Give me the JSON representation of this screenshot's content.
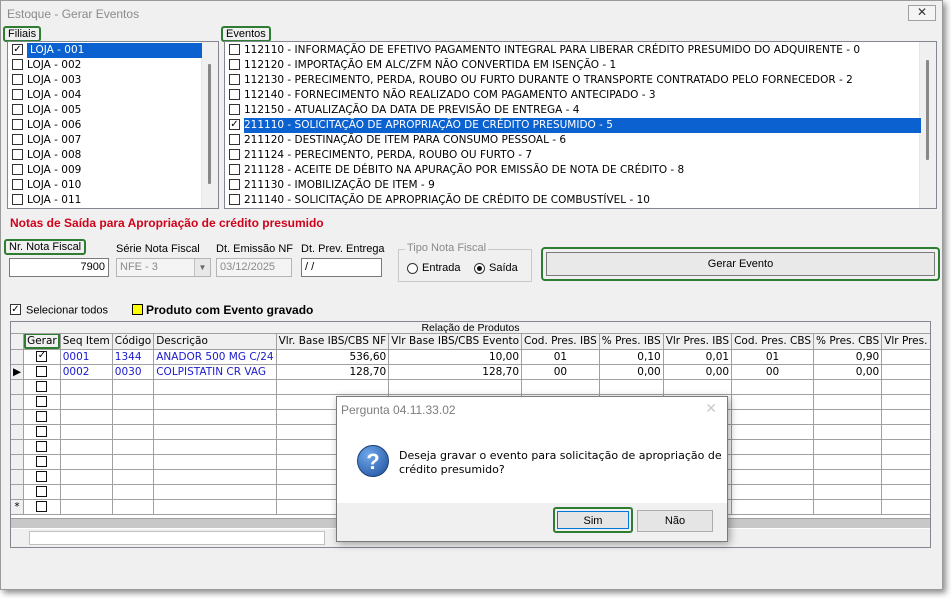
{
  "window": {
    "title": "Estoque - Gerar Eventos",
    "close_glyph": "✕"
  },
  "filiais": {
    "label": "Filiais",
    "items": [
      {
        "label": "LOJA - 001",
        "checked": true,
        "selected": true
      },
      {
        "label": "LOJA - 002",
        "checked": false
      },
      {
        "label": "LOJA - 003",
        "checked": false
      },
      {
        "label": "LOJA - 004",
        "checked": false
      },
      {
        "label": "LOJA - 005",
        "checked": false
      },
      {
        "label": "LOJA - 006",
        "checked": false
      },
      {
        "label": "LOJA - 007",
        "checked": false
      },
      {
        "label": "LOJA - 008",
        "checked": false
      },
      {
        "label": "LOJA - 009",
        "checked": false
      },
      {
        "label": "LOJA - 010",
        "checked": false
      },
      {
        "label": "LOJA - 011",
        "checked": false
      }
    ]
  },
  "eventos": {
    "label": "Eventos",
    "items": [
      {
        "label": "112110 - INFORMAÇÃO DE EFETIVO PAGAMENTO INTEGRAL PARA LIBERAR CRÉDITO PRESUMIDO DO ADQUIRENTE - 0",
        "checked": false
      },
      {
        "label": "112120 - IMPORTAÇÃO EM ALC/ZFM NÃO CONVERTIDA EM ISENÇÃO - 1",
        "checked": false
      },
      {
        "label": "112130 - PERECIMENTO, PERDA, ROUBO OU FURTO DURANTE O TRANSPORTE CONTRATADO PELO FORNECEDOR - 2",
        "checked": false
      },
      {
        "label": "112140 - FORNECIMENTO NÃO REALIZADO COM PAGAMENTO ANTECIPADO - 3",
        "checked": false
      },
      {
        "label": "112150 - ATUALIZAÇÃO DA DATA DE PREVISÃO DE ENTREGA - 4",
        "checked": false
      },
      {
        "label": "211110 - SOLICITAÇÃO DE APROPRIAÇÃO DE CRÉDITO PRESUMIDO - 5",
        "checked": true,
        "selected": true
      },
      {
        "label": "211120 - DESTINAÇÃO DE ITEM PARA CONSUMO PESSOAL - 6",
        "checked": false
      },
      {
        "label": "211124 - PERECIMENTO, PERDA, ROUBO OU FURTO - 7",
        "checked": false
      },
      {
        "label": "211128 - ACEITE DE DÉBITO NA APURAÇÃO POR EMISSÃO DE NOTA DE CRÉDITO - 8",
        "checked": false
      },
      {
        "label": "211130 - IMOBILIZAÇÃO DE ITEM - 9",
        "checked": false
      },
      {
        "label": "211140 - SOLICITAÇÃO DE APROPRIAÇÃO DE CRÉDITO DE COMBUSTÍVEL - 10",
        "checked": false
      }
    ]
  },
  "section_title": "Notas de Saída para Apropriação de crédito presumido",
  "form": {
    "nr_nota_label": "Nr. Nota Fiscal",
    "nr_nota_value": "7900",
    "serie_label": "Série Nota Fiscal",
    "serie_value": "NFE - 3",
    "emissao_label": "Dt. Emissão NF",
    "emissao_value": "03/12/2025",
    "prev_entrega_label": "Dt. Prev. Entrega",
    "prev_entrega_value": " /  /",
    "tipo_label": "Tipo Nota Fiscal",
    "entrada_label": "Entrada",
    "saida_label": "Saída",
    "tipo_selected": "Saída",
    "gerar_evento_label": "Gerar Evento"
  },
  "options": {
    "selecionar_todos_label": "Selecionar todos",
    "selecionar_todos_checked": true,
    "legend_label": "Produto com Evento gravado",
    "legend_color": "#ffff00"
  },
  "grid": {
    "caption": "Relação de Produtos",
    "columns": [
      "Gerar",
      "Seq Item",
      "Código",
      "Descrição",
      "Vlr. Base IBS/CBS NF",
      "Vlr Base IBS/CBS Evento",
      "Cod. Pres. IBS",
      "% Pres. IBS",
      "Vlr Pres. IBS",
      "Cod. Pres. CBS",
      "% Pres. CBS",
      "Vlr Pres. C"
    ],
    "rows": [
      {
        "indicator": "",
        "gerar": true,
        "seq": "0001",
        "codigo": "1344",
        "descricao": "ANADOR 500 MG C/24",
        "base_nf": "536,60",
        "base_evento": "10,00",
        "cod_ibs": "01",
        "pct_ibs": "0,10",
        "vlr_ibs": "0,01",
        "cod_cbs": "01",
        "pct_cbs": "0,90",
        "vlr_cbs": ""
      },
      {
        "indicator": "▶",
        "gerar": false,
        "seq": "0002",
        "codigo": "0030",
        "descricao": "COLPISTATIN CR VAG",
        "base_nf": "128,70",
        "base_evento": "128,70",
        "cod_ibs": "00",
        "pct_ibs": "0,00",
        "vlr_ibs": "0,00",
        "cod_cbs": "00",
        "pct_cbs": "0,00",
        "vlr_cbs": ""
      }
    ],
    "new_row_indicator": "*"
  },
  "dialog": {
    "title": "Pergunta 04.11.33.02",
    "close_glyph": "✕",
    "icon": "question-icon",
    "icon_glyph": "?",
    "message_line1": "Deseja gravar o evento para solicitação de apropriação de",
    "message_line2": "crédito presumido?",
    "yes_label": "Sim",
    "no_label": "Não"
  }
}
